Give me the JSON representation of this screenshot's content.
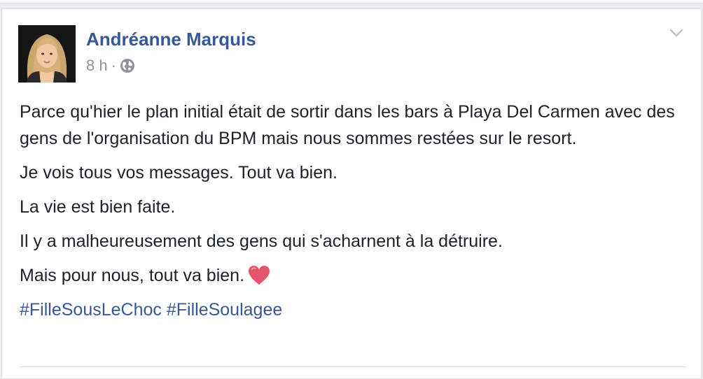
{
  "post": {
    "author": "Andréanne Marquis",
    "time": "8 h",
    "separator": "·",
    "privacy_icon": "globe-icon",
    "menu_icon": "chevron-down-icon",
    "paragraphs": [
      "Parce qu'hier le plan initial était de sortir dans les bars à Playa Del Carmen avec des gens de l'organisation du BPM mais nous sommes restées sur le resort.",
      "Je vois tous vos messages. Tout va bien.",
      "La vie est bien faite.",
      "Il y a malheureusement des gens qui s'acharnent à la détruire.",
      "Mais pour nous, tout va bien."
    ],
    "emoji_icon": "heart-icon",
    "hashtags": [
      "#FilleSousLeChoc",
      "#FilleSoulagee"
    ]
  },
  "colors": {
    "link": "#365899",
    "text": "#1d2129",
    "meta": "#90949c",
    "heart": "#e5566b"
  }
}
